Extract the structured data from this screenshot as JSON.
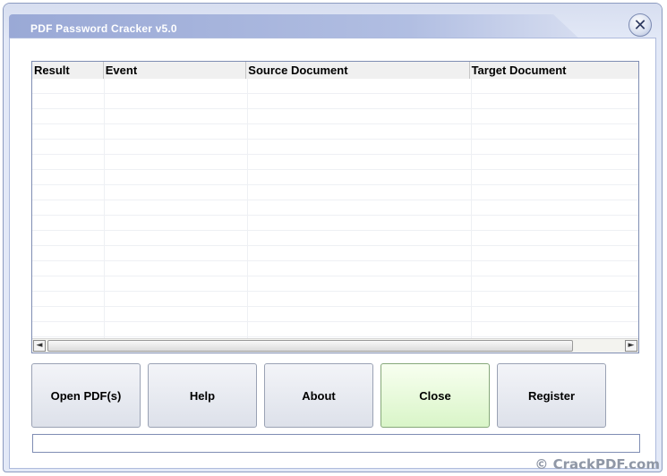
{
  "window": {
    "title": "PDF Password Cracker v5.0",
    "close_glyph": "✕"
  },
  "table": {
    "columns": [
      "Result",
      "Event",
      "Source Document",
      "Target Document"
    ],
    "rows": []
  },
  "scrollbar": {
    "left_glyph": "◄",
    "right_glyph": "►"
  },
  "buttons": {
    "open": "Open PDF(s)",
    "help": "Help",
    "about": "About",
    "close": "Close",
    "register": "Register"
  },
  "status": {
    "text": ""
  },
  "watermark": "© CrackPDF.com",
  "colors": {
    "title_bar": "#9aa9d6",
    "active_button": "#d9f5c8",
    "frame": "#e3e9f7"
  }
}
